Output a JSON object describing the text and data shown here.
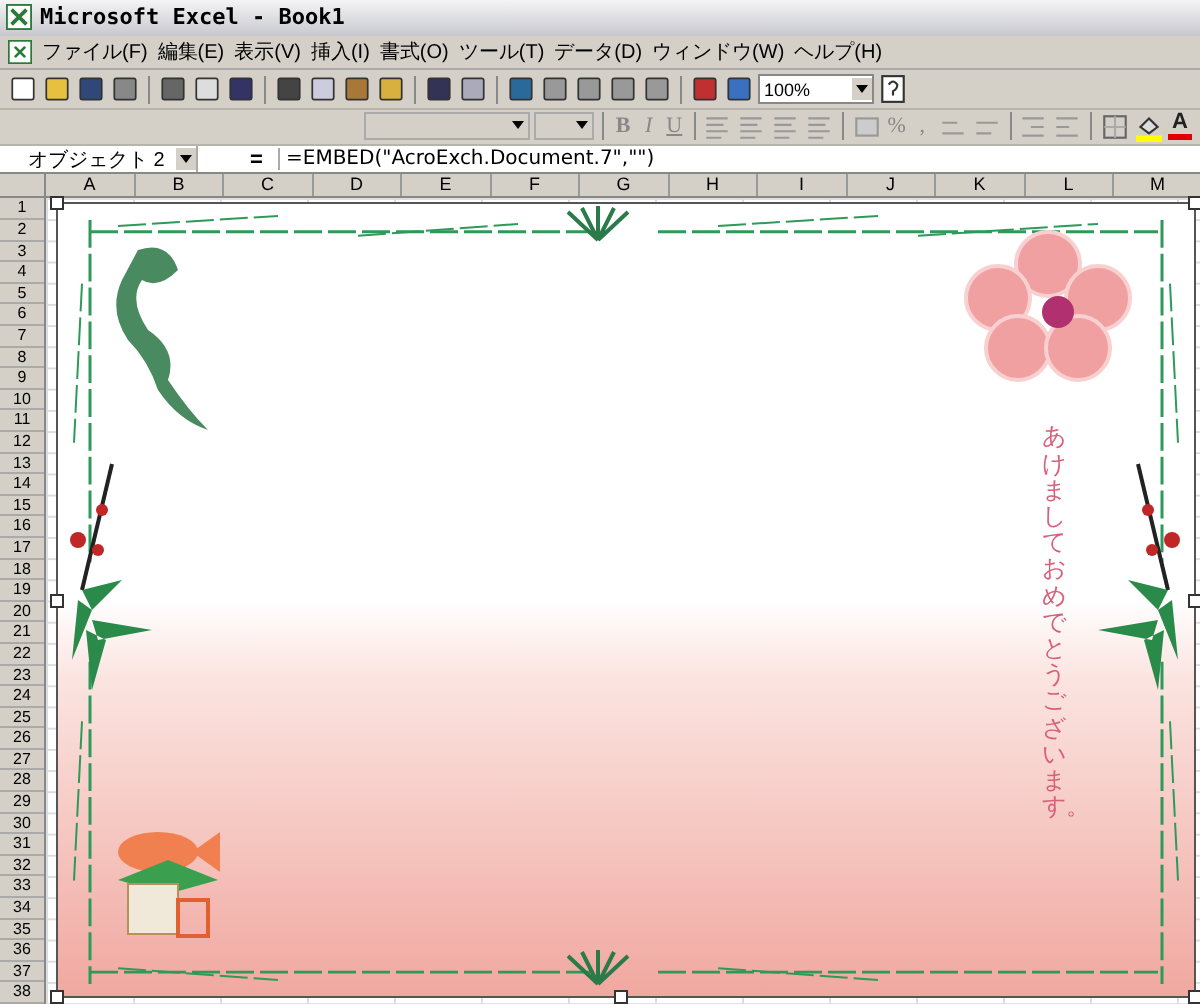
{
  "window": {
    "title": "Microsoft Excel - Book1"
  },
  "menu": [
    "ファイル(F)",
    "編集(E)",
    "表示(V)",
    "挿入(I)",
    "書式(O)",
    "ツール(T)",
    "データ(D)",
    "ウィンドウ(W)",
    "ヘルプ(H)"
  ],
  "toolbar": {
    "zoom": "100%"
  },
  "format_toolbar": {
    "style_buttons": [
      "B",
      "I",
      "U"
    ],
    "number_buttons": [
      "%",
      ","
    ],
    "font_color": "A"
  },
  "name_box": "オブジェクト 2",
  "formula_label": "=",
  "formula": "=EMBED(\"AcroExch.Document.7\",\"\")",
  "columns": [
    "A",
    "B",
    "C",
    "D",
    "E",
    "F",
    "G",
    "H",
    "I",
    "J",
    "K",
    "L",
    "M"
  ],
  "rows": [
    "1",
    "2",
    "3",
    "4",
    "5",
    "6",
    "7",
    "8",
    "9",
    "10",
    "11",
    "12",
    "13",
    "14",
    "15",
    "16",
    "17",
    "18",
    "19",
    "20",
    "21",
    "22",
    "23",
    "24",
    "25",
    "26",
    "27",
    "28",
    "29",
    "30",
    "31",
    "32",
    "33",
    "34",
    "35",
    "36",
    "37",
    "38"
  ],
  "card": {
    "greeting": "あけましておめでとうございます。"
  }
}
